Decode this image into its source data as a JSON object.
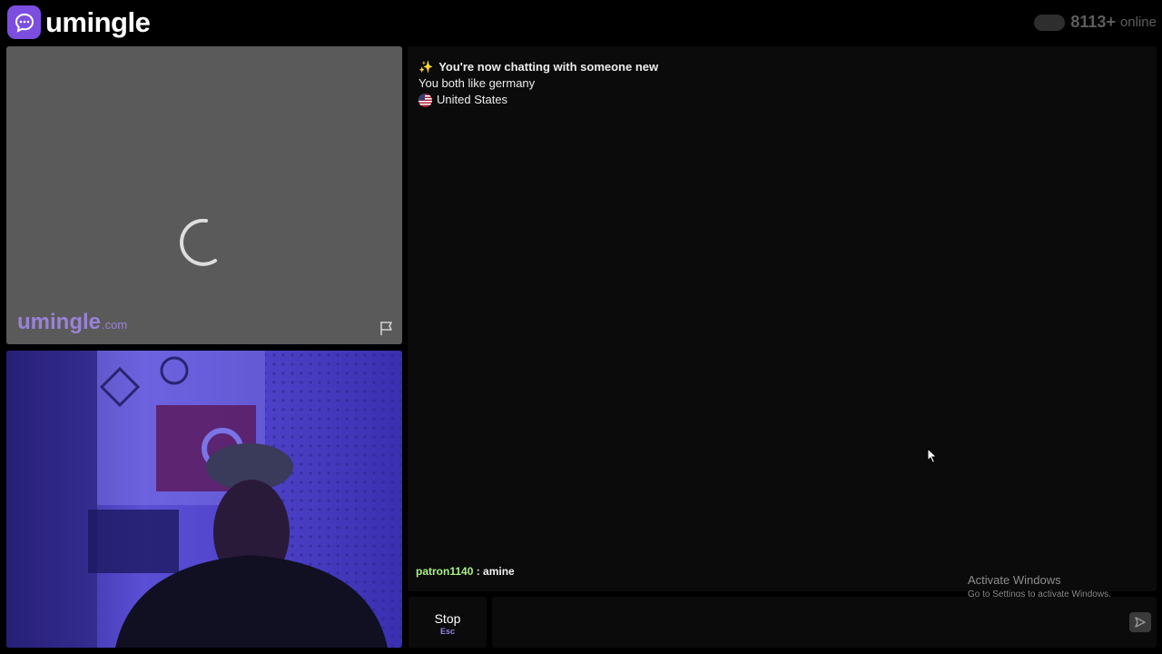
{
  "header": {
    "logo_text": "umingle",
    "online_count": "8113+",
    "online_label": "online"
  },
  "video_remote": {
    "watermark_main": "umingle",
    "watermark_suffix": ".com"
  },
  "chat": {
    "system_messages": [
      {
        "icon": "sparkles-icon",
        "text": "You're now chatting with someone new"
      },
      {
        "text": "You both like germany"
      },
      {
        "icon": "us-flag-icon",
        "text": "United States"
      }
    ],
    "messages": [
      {
        "user": "patron1140",
        "separator": " : ",
        "text": "amine"
      }
    ]
  },
  "controls": {
    "stop_label": "Stop",
    "stop_shortcut": "Esc",
    "input_value": "",
    "input_placeholder": ""
  },
  "os_overlay": {
    "activate_title": "Activate Windows",
    "activate_subtitle": "Go to Settings to activate Windows."
  },
  "colors": {
    "brand": "#7b4ee0",
    "username": "#a9ee8a",
    "shortcut": "#9b7fea"
  }
}
